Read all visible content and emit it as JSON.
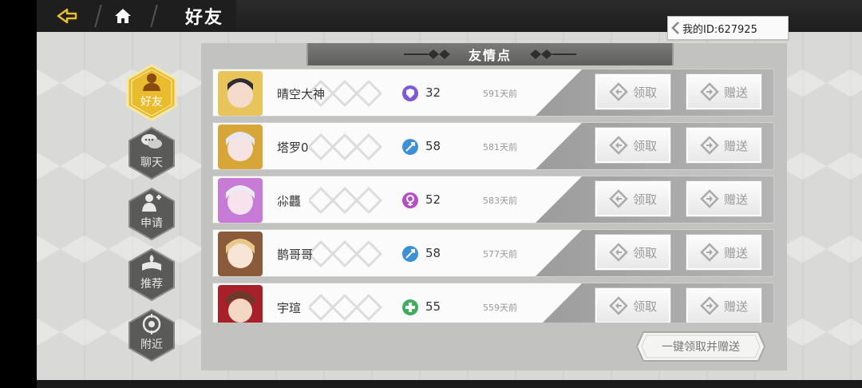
{
  "header": {
    "title": "好友"
  },
  "id_badge": {
    "text": "我的ID:627925"
  },
  "nav": [
    {
      "label": "好友",
      "icon": "friend-icon",
      "active": true
    },
    {
      "label": "聊天",
      "icon": "chat-icon",
      "active": false
    },
    {
      "label": "申请",
      "icon": "request-icon",
      "active": false
    },
    {
      "label": "推荐",
      "icon": "recommend-icon",
      "active": false
    },
    {
      "label": "附近",
      "icon": "nearby-icon",
      "active": false
    }
  ],
  "panel": {
    "title": "友情点",
    "receive_label": "领取",
    "send_label": "赠送",
    "one_key_label": "一键领取并赠送"
  },
  "friends": [
    {
      "name": "晴空大神",
      "points": "32",
      "time": "591天前",
      "icon": "shield-class-icon",
      "color": "#7d5bd6"
    },
    {
      "name": "塔罗0",
      "points": "58",
      "time": "581天前",
      "icon": "bow-class-icon",
      "color": "#3d8fd6"
    },
    {
      "name": "尛龘",
      "points": "52",
      "time": "583天前",
      "icon": "mage-class-icon",
      "color": "#b44fc7"
    },
    {
      "name": "鹊哥哥",
      "points": "58",
      "time": "577天前",
      "icon": "bow-class-icon",
      "color": "#3d8fd6"
    },
    {
      "name": "宇瑄",
      "points": "55",
      "time": "559天前",
      "icon": "healer-class-icon",
      "color": "#3fae5a"
    }
  ],
  "colors": {
    "accent_gold": "#e8bc2c",
    "topbar": "#1e1e1e"
  }
}
